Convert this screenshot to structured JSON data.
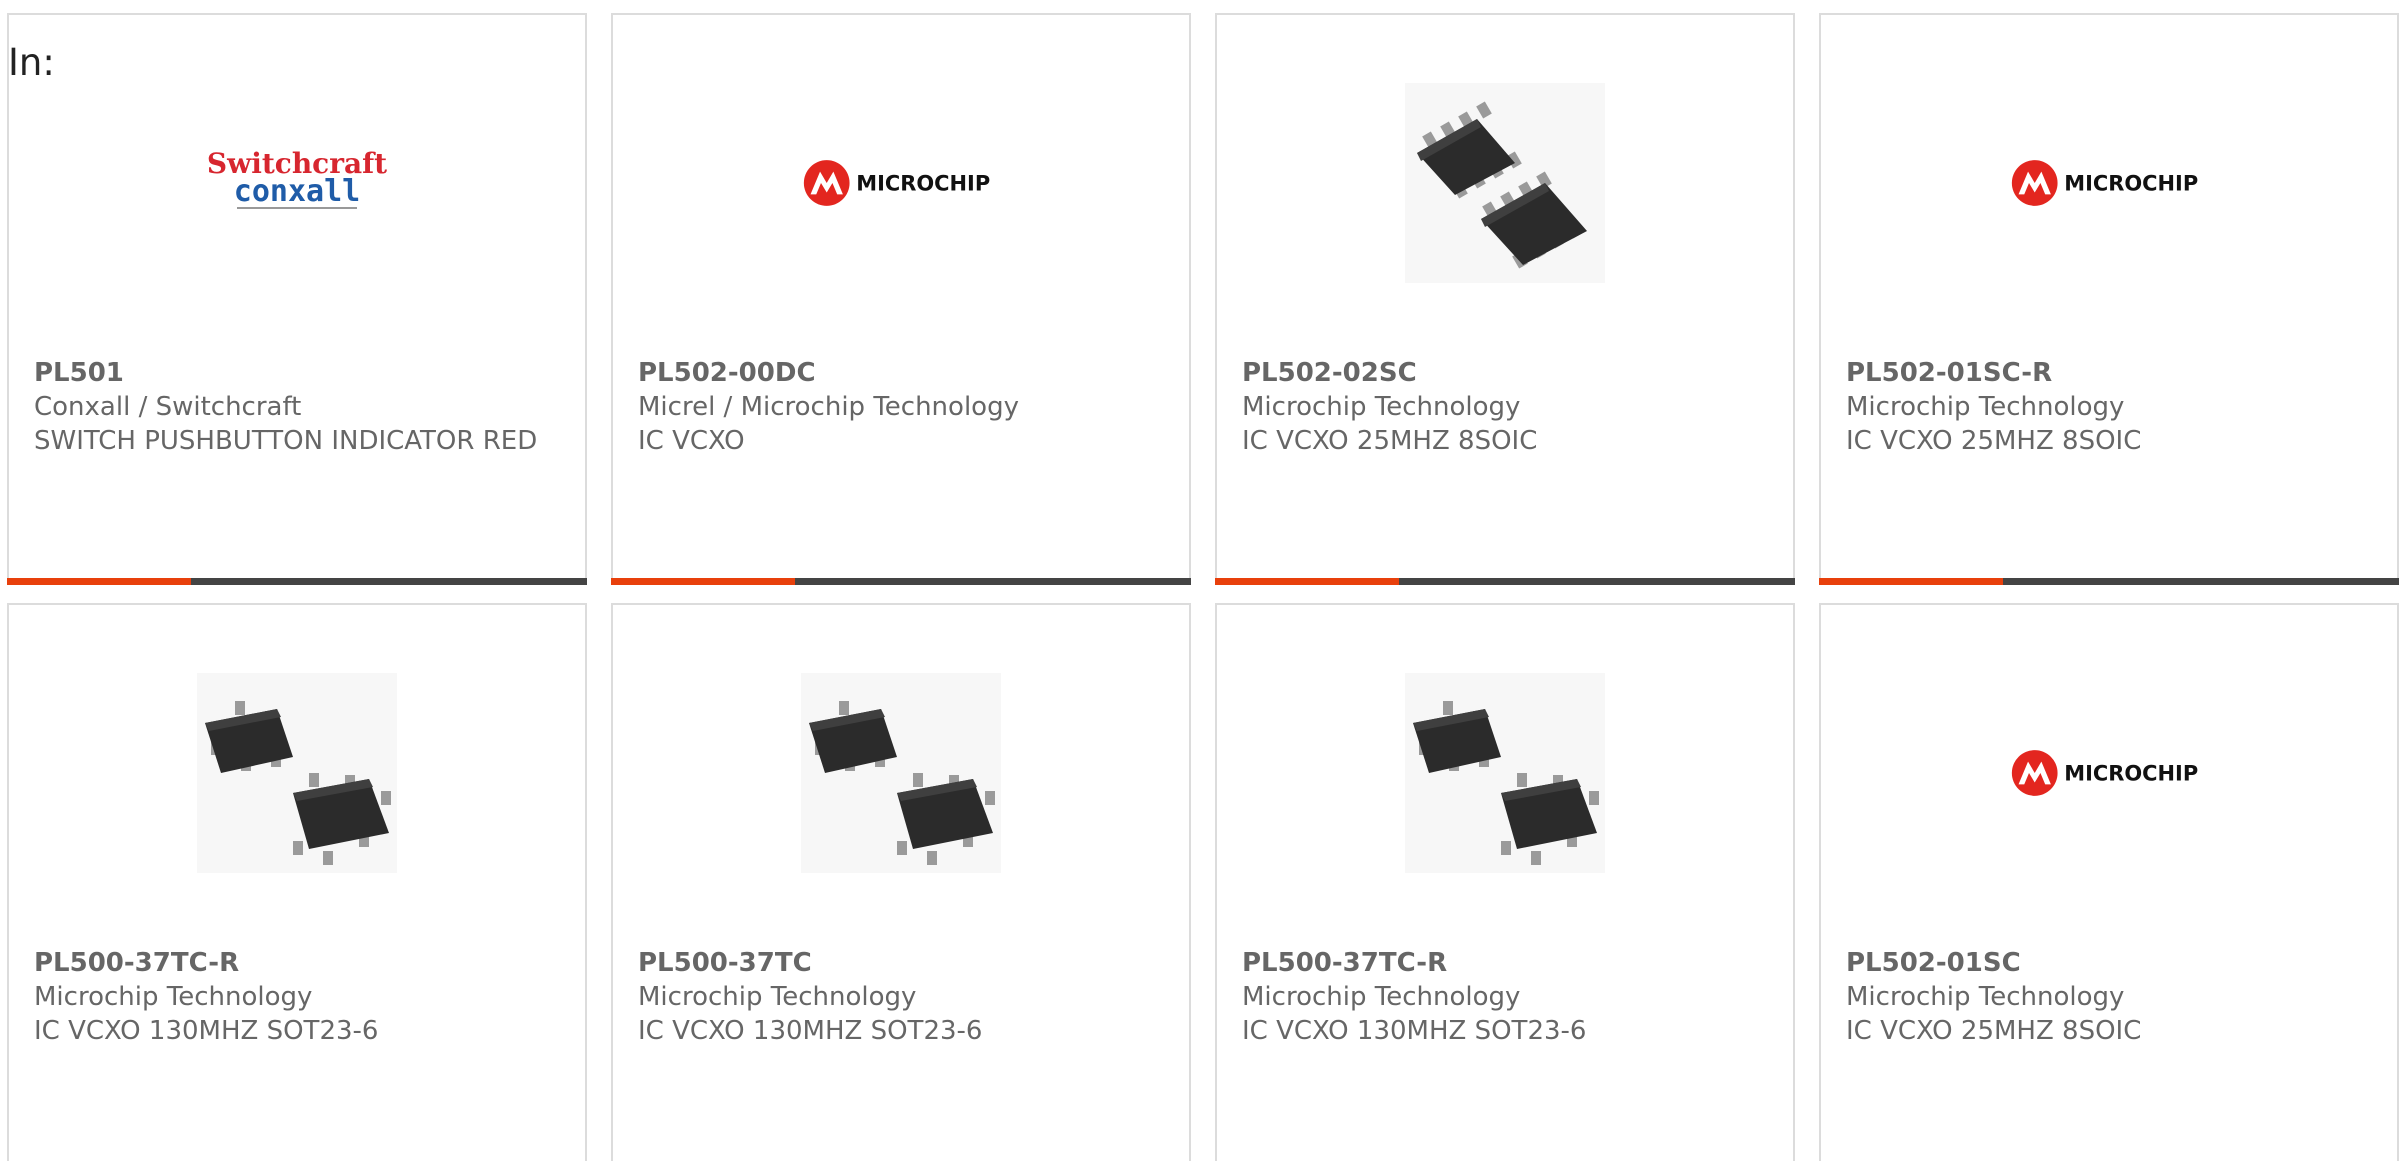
{
  "header": {
    "label": "In:"
  },
  "colors": {
    "accent": "#e8400c",
    "bar": "#444444",
    "border": "#dcdcdc",
    "text": "#666666"
  },
  "products": [
    {
      "part": "PL501",
      "manufacturer": "Conxall / Switchcraft",
      "description": "SWITCH PUSHBUTTON INDICATOR RED",
      "image": "switchcraft-conxall-logo"
    },
    {
      "part": "PL502-00DC",
      "manufacturer": "Micrel / Microchip Technology",
      "description": "IC VCXO",
      "image": "microchip-logo"
    },
    {
      "part": "PL502-02SC",
      "manufacturer": "Microchip Technology",
      "description": "IC VCXO 25MHZ 8SOIC",
      "image": "soic8-chip-photo"
    },
    {
      "part": "PL502-01SC-R",
      "manufacturer": "Microchip Technology",
      "description": "IC VCXO 25MHZ 8SOIC",
      "image": "microchip-logo"
    },
    {
      "part": "PL500-37TC-R",
      "manufacturer": "Microchip Technology",
      "description": "IC VCXO 130MHZ SOT23-6",
      "image": "sot23-chip-photo"
    },
    {
      "part": "PL500-37TC",
      "manufacturer": "Microchip Technology",
      "description": "IC VCXO 130MHZ SOT23-6",
      "image": "sot23-chip-photo"
    },
    {
      "part": "PL500-37TC-R",
      "manufacturer": "Microchip Technology",
      "description": "IC VCXO 130MHZ SOT23-6",
      "image": "sot23-chip-photo"
    },
    {
      "part": "PL502-01SC",
      "manufacturer": "Microchip Technology",
      "description": "IC VCXO 25MHZ 8SOIC",
      "image": "microchip-logo"
    }
  ],
  "logos": {
    "switchcraft": {
      "line1": "Switchcraft",
      "line2": "conxall"
    },
    "microchip": {
      "text": "MICROCHIP"
    }
  }
}
